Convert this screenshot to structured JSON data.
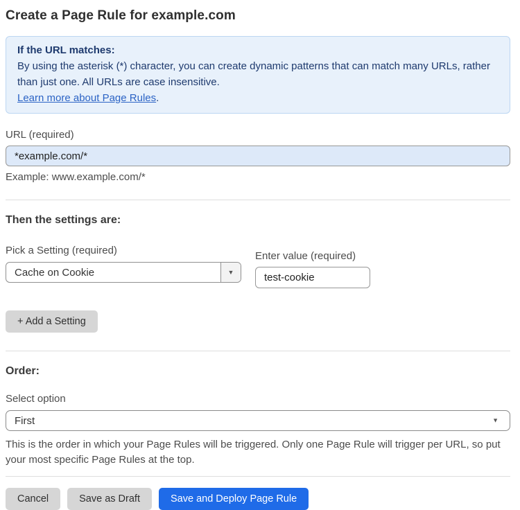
{
  "page": {
    "title": "Create a Page Rule for example.com"
  },
  "info_box": {
    "heading": "If the URL matches:",
    "body": "By using the asterisk (*) character, you can create dynamic patterns that can match many URLs, rather than just one. All URLs are case insensitive.",
    "link_label": "Learn more about Page Rules",
    "link_suffix": "."
  },
  "url_field": {
    "label": "URL (required)",
    "value": "*example.com/*",
    "helper": "Example: www.example.com/*"
  },
  "settings_section": {
    "heading": "Then the settings are:",
    "setting_select": {
      "label": "Pick a Setting (required)",
      "selected_value": "Cache on Cookie",
      "caret_icon": "▼"
    },
    "value_field": {
      "label": "Enter value (required)",
      "value": "test-cookie"
    },
    "add_button_label": "+ Add a Setting"
  },
  "order_section": {
    "heading": "Order:",
    "select_label": "Select option",
    "selected_option": "First",
    "caret_icon": "▼",
    "helper": "This is the order in which your Page Rules will be triggered. Only one Page Rule will trigger per URL, so put your most specific Page Rules at the top."
  },
  "footer": {
    "cancel_label": "Cancel",
    "save_draft_label": "Save as Draft",
    "save_deploy_label": "Save and Deploy Page Rule"
  },
  "colors": {
    "info_box_bg": "#e8f1fb",
    "info_box_border": "#bcd6f2",
    "info_text": "#1e3a6e",
    "link": "#2b63c5",
    "url_input_bg": "#dde9f9",
    "primary_button": "#1f6be8",
    "secondary_button": "#d6d6d6"
  }
}
